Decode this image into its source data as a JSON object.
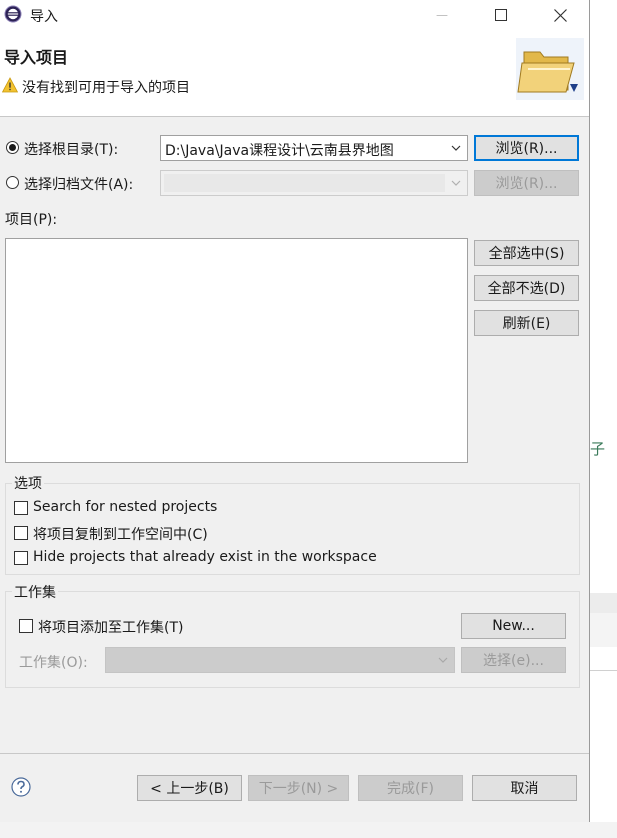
{
  "background": {
    "text_fragment": "子"
  },
  "window": {
    "title": "导入",
    "minimize_glyph": "—",
    "maximize_glyph": "☐",
    "close_glyph": "✕"
  },
  "header": {
    "title": "导入项目",
    "message": "没有找到可用于导入的项目",
    "warning_icon": "warning-icon",
    "banner_icon": "folder-open-icon"
  },
  "source": {
    "root_dir": {
      "label": "选择根目录(T):",
      "selected": true,
      "value": "D:\\Java\\Java课程设计\\云南县界地图",
      "browse": "浏览(R)..."
    },
    "archive": {
      "label": "选择归档文件(A):",
      "selected": false,
      "value": "",
      "browse": "浏览(R)..."
    }
  },
  "projects": {
    "label": "项目(P):",
    "items": [],
    "select_all": "全部选中(S)",
    "deselect_all": "全部不选(D)",
    "refresh": "刷新(E)"
  },
  "options": {
    "title": "选项",
    "items": [
      {
        "label": "Search for nested projects",
        "checked": false
      },
      {
        "label": "将项目复制到工作空间中(C)",
        "checked": false
      },
      {
        "label": "Hide projects that already exist in the workspace",
        "checked": false
      }
    ]
  },
  "working_sets": {
    "title": "工作集",
    "add_label": "将项目添加至工作集(T)",
    "add_checked": false,
    "new_button": "New...",
    "sets_label": "工作集(O):",
    "sets_value": "",
    "select_button": "选择(e)..."
  },
  "footer": {
    "help_icon": "help-icon",
    "back": "< 上一步(B)",
    "next": "下一步(N) >",
    "finish": "完成(F)",
    "cancel": "取消"
  },
  "colors": {
    "accent": "#0078d7",
    "dialog_bg": "#f0f0f0",
    "disabled_text": "#9a9a9a"
  }
}
